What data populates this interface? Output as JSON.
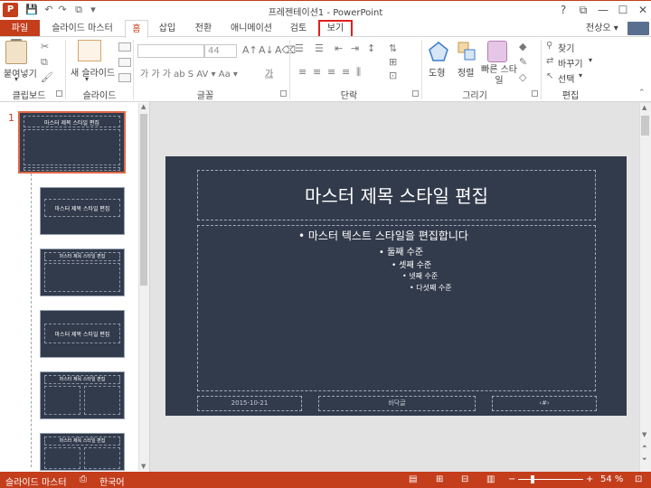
{
  "app": {
    "icon_letter": "P",
    "title": "프레젠테이션1 - PowerPoint"
  },
  "qat": {
    "save": "💾",
    "undo": "↶",
    "redo": "↷",
    "start": "⧉",
    "more": "▾"
  },
  "window": {
    "help": "?",
    "restore": "⧉",
    "minimize": "—",
    "maximize": "☐",
    "close": "✕"
  },
  "tabs": {
    "file": "파일",
    "slide_master": "슬라이드 마스터",
    "home": "홈",
    "insert": "삽입",
    "transitions": "전환",
    "animations": "애니메이션",
    "review": "검토",
    "view": "보기"
  },
  "user": {
    "name": "전상오 ▾"
  },
  "ribbon": {
    "clipboard": {
      "paste": "붙여넣기",
      "paste_arrow": "▾",
      "label": "클립보드"
    },
    "slides": {
      "new_slide": "새 슬라이드",
      "new_slide_arrow": "▾",
      "label": "슬라이드"
    },
    "font": {
      "size": "44",
      "label": "글꼴",
      "bold_row": "가  가  가  ab  S  AV ▾  Aa ▾",
      "color": "가"
    },
    "paragraph": {
      "label": "단락"
    },
    "drawing": {
      "shapes": "도형",
      "arrange": "정렬",
      "quick_styles": "빠른 스타일",
      "label": "그리기"
    },
    "editing": {
      "find": "찾기",
      "replace": "바꾸기",
      "replace_arrow": "▾",
      "select": "선택",
      "select_arrow": "▾",
      "label": "편집"
    }
  },
  "thumbnails": {
    "master_number": "1",
    "master_title": "마스터 제목 스타일 편집",
    "layout_title": "마스터 제목 스타일 편집"
  },
  "slide": {
    "title": "마스터 제목 스타일 편집",
    "level1": "• 마스터 텍스트 스타일을 편집합니다",
    "level2": "• 둘째 수준",
    "level3": "• 셋째 수준",
    "level4": "• 넷째 수준",
    "level5": "• 다섯째 수준",
    "footer_date": "2015-10-21",
    "footer_text": "바닥글",
    "footer_number": "‹#›"
  },
  "status": {
    "mode": "슬라이드 마스터",
    "language": "한국어",
    "zoom_minus": "−",
    "zoom_plus": "+",
    "zoom": "54 %",
    "zoom_level": 54
  },
  "colors": {
    "accent": "#c43e1c",
    "slide_bg": "#323b4b",
    "highlight": "#e02020"
  }
}
